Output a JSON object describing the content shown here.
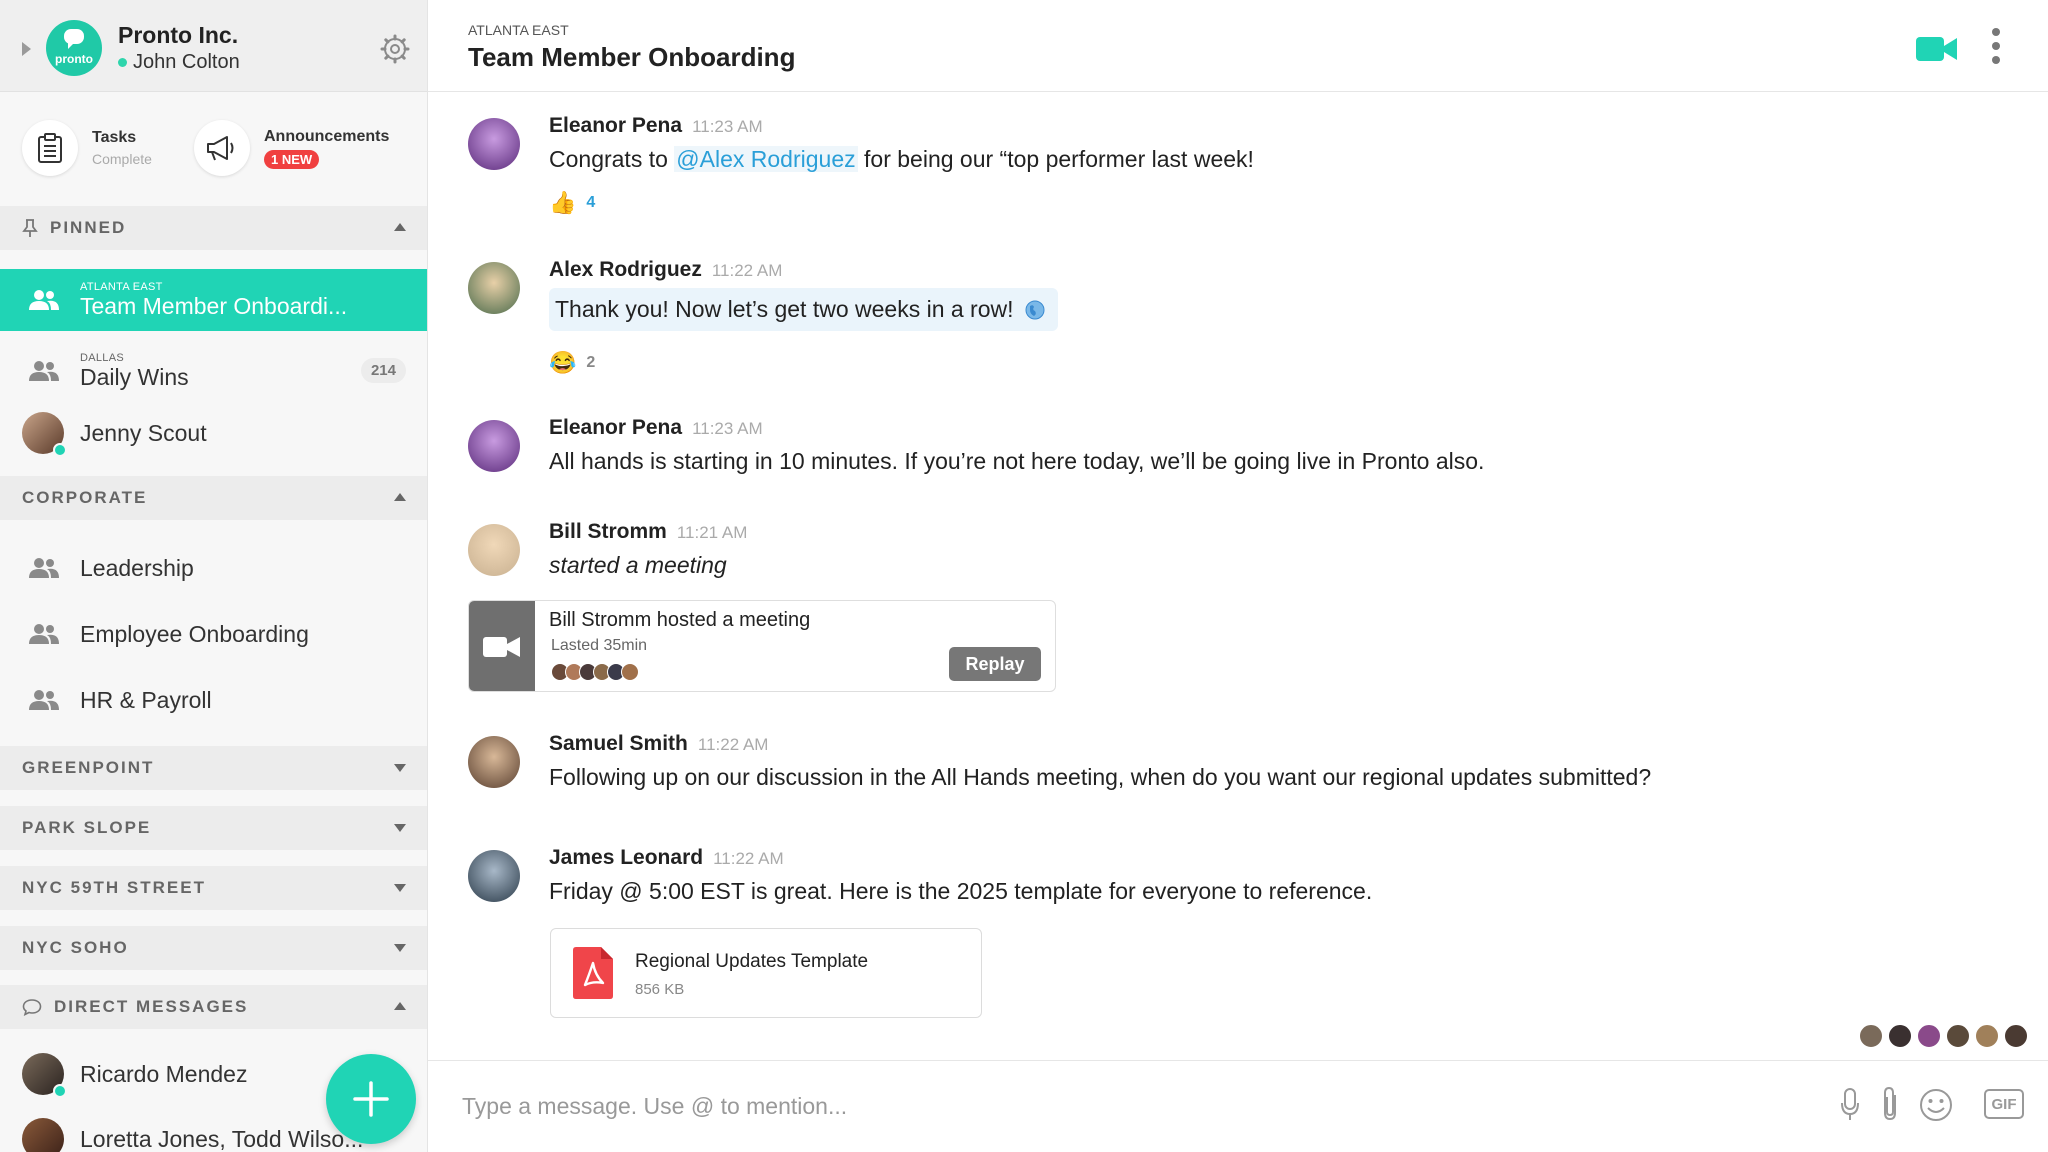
{
  "org": {
    "name": "Pronto Inc.",
    "user": "John Colton",
    "logo_word": "pronto"
  },
  "quick": {
    "tasks_label": "Tasks",
    "tasks_status": "Complete",
    "announcements_label": "Announcements",
    "announcements_badge": "1 NEW"
  },
  "sections": {
    "pinned": "PINNED",
    "corporate": "CORPORATE",
    "greenpoint": "GREENPOINT",
    "park_slope": "PARK SLOPE",
    "nyc_59th": "NYC 59TH STREET",
    "nyc_soho": "NYC SOHO",
    "direct_messages": "DIRECT MESSAGES"
  },
  "pinned": [
    {
      "loc": "ATLANTA EAST",
      "name": "Team Member Onboardi..."
    },
    {
      "loc": "DALLAS",
      "name": "Daily Wins",
      "count": "214"
    },
    {
      "name": "Jenny Scout"
    }
  ],
  "corporate": [
    {
      "name": "Leadership"
    },
    {
      "name": "Employee Onboarding"
    },
    {
      "name": "HR & Payroll"
    }
  ],
  "dms": [
    {
      "name": "Ricardo Mendez"
    },
    {
      "name": "Loretta Jones, Todd Wilso..."
    }
  ],
  "channel": {
    "loc": "ATLANTA EAST",
    "title": "Team Member Onboarding"
  },
  "messages": [
    {
      "author": "Eleanor Pena",
      "time": "11:23 AM",
      "pre": "Congrats to ",
      "mention": "@Alex Rodriguez",
      "post": " for being our “top performer last week!",
      "reaction_count": "4"
    },
    {
      "author": "Alex Rodriguez",
      "time": "11:22 AM",
      "text": "Thank you! Now let’s get two weeks in a row!",
      "reaction_count": "2"
    },
    {
      "author": "Eleanor Pena",
      "time": "11:23 AM",
      "text": "All hands is starting in 10 minutes. If you’re not here today, we’ll be going live in Pronto also."
    },
    {
      "author": "Bill Stromm",
      "time": "11:21 AM",
      "text": "started a meeting"
    },
    {
      "author": "Samuel Smith",
      "time": "11:22 AM",
      "text": "Following up on our discussion in the All Hands meeting, when do you want our regional updates submitted?"
    },
    {
      "author": "James Leonard",
      "time": "11:22 AM",
      "text": "Friday @ 5:00 EST is great. Here is the 2025 template for everyone to reference."
    }
  ],
  "meeting": {
    "title": "Bill Stromm hosted a meeting",
    "duration": "Lasted 35min",
    "replay": "Replay"
  },
  "file": {
    "name": "Regional Updates Template",
    "size": "856 KB"
  },
  "composer": {
    "placeholder": "Type a message. Use @ to mention...",
    "gif": "GIF"
  },
  "colors": {
    "accent": "#20d4b5",
    "mention": "#2a9fd8",
    "badge_red": "#f04040"
  }
}
